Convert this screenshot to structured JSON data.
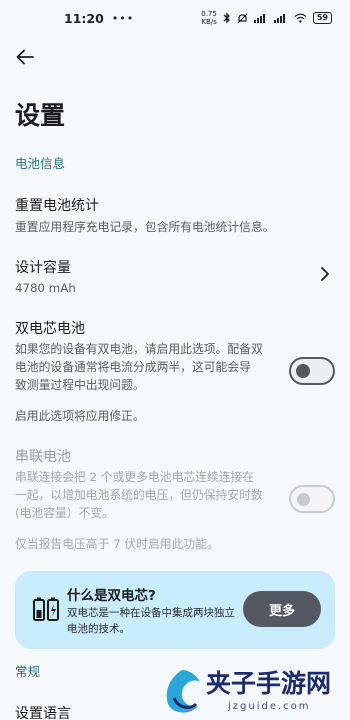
{
  "status_bar": {
    "time": "11:20",
    "dots": "•••",
    "net_speed_value": "0.75",
    "net_speed_unit": "KB/s",
    "battery": "59"
  },
  "header": {
    "title": "设置"
  },
  "battery_section": {
    "heading": "电池信息",
    "reset": {
      "title": "重置电池统计",
      "desc": "重置应用程序充电记录，包含所有电池统计信息。"
    },
    "design_capacity": {
      "title": "设计容量",
      "value": "4780 mAh"
    },
    "dual_cell": {
      "title": "双电芯电池",
      "desc_lines": [
        "如果您的设备有双电池，请启用此选项。配备双",
        "电池的设备通常将电流分成两半，这可能会导",
        "致测量过程中出现问题。"
      ],
      "note": "启用此选项将应用修正。",
      "enabled": false
    },
    "series_cell": {
      "title": "串联电池",
      "desc_lines": [
        "串联连接会把 2 个或更多电池电芯连续连接在",
        "一起，以增加电池系统的电压，但仍保持安时数",
        "(电池容量）不变。"
      ],
      "note": "仅当报告电压高于 7 伏时启用此功能。",
      "enabled": false
    }
  },
  "info_card": {
    "title": "什么是双电芯?",
    "desc": "双电芯是一种在设备中集成两块独立电池的技术。",
    "button": "更多"
  },
  "general_section": {
    "heading": "常规",
    "language_title": "设置语言"
  },
  "watermark": {
    "text": "夹子手游网",
    "sub": "jzguide.com"
  },
  "colors": {
    "accent": "#2f7182",
    "card_bg": "#c9ecfb",
    "button_bg": "#545862"
  }
}
